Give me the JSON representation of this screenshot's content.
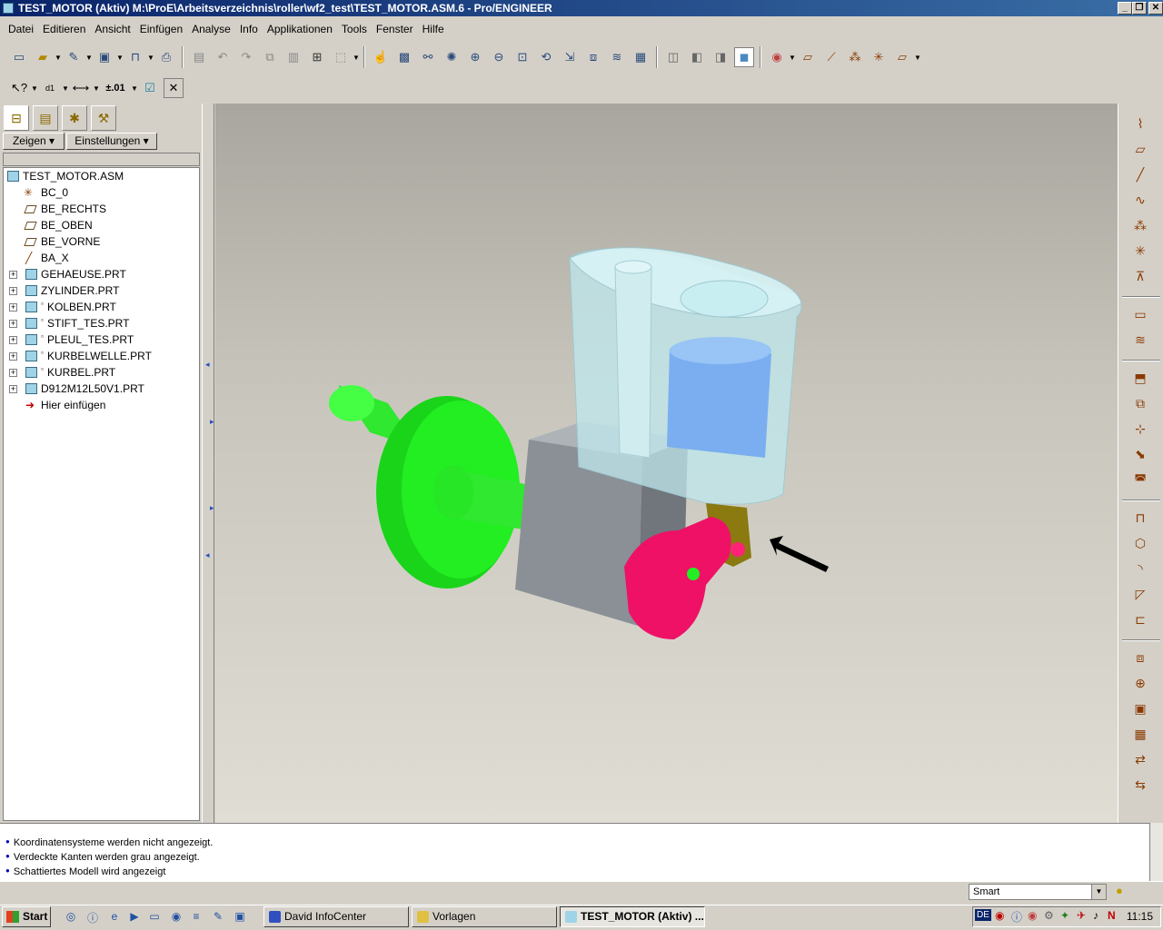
{
  "window": {
    "title": "TEST_MOTOR (Aktiv) M:\\ProE\\Arbeitsverzeichnis\\roller\\wf2_test\\TEST_MOTOR.ASM.6 - Pro/ENGINEER",
    "minimize": "_",
    "restore": "❐",
    "close": "✕"
  },
  "menu": [
    "Datei",
    "Editieren",
    "Ansicht",
    "Einfügen",
    "Analyse",
    "Info",
    "Applikationen",
    "Tools",
    "Fenster",
    "Hilfe"
  ],
  "toolbar": {
    "tolerance_label": "±.01"
  },
  "panel": {
    "show_button": "Zeigen ▾",
    "settings_button": "Einstellungen ▾"
  },
  "tree": {
    "root": "TEST_MOTOR.ASM",
    "items": [
      {
        "label": "BC_0",
        "kind": "csys",
        "icon": "✳"
      },
      {
        "label": "BE_RECHTS",
        "kind": "plane"
      },
      {
        "label": "BE_OBEN",
        "kind": "plane"
      },
      {
        "label": "BE_VORNE",
        "kind": "plane"
      },
      {
        "label": "BA_X",
        "kind": "axis",
        "icon": "╱"
      },
      {
        "label": "GEHAEUSE.PRT",
        "kind": "part"
      },
      {
        "label": "ZYLINDER.PRT",
        "kind": "part"
      },
      {
        "label": "KOLBEN.PRT",
        "kind": "part",
        "mark": "▫"
      },
      {
        "label": "STIFT_TES.PRT",
        "kind": "part",
        "mark": "▫"
      },
      {
        "label": "PLEUL_TES.PRT",
        "kind": "part",
        "mark": "▫"
      },
      {
        "label": "KURBELWELLE.PRT",
        "kind": "part",
        "mark": "▫"
      },
      {
        "label": "KURBEL.PRT",
        "kind": "part",
        "mark": "▫"
      },
      {
        "label": "D912M12L50V1.PRT",
        "kind": "part"
      },
      {
        "label": "Hier einfügen",
        "kind": "insert",
        "icon": "➜"
      }
    ]
  },
  "messages": [
    "Koordinatensysteme werden nicht angezeigt.",
    "Verdeckte Kanten werden grau angezeigt.",
    "Schattiertes Modell wird angezeigt"
  ],
  "status": {
    "filter": "Smart"
  },
  "taskbar": {
    "start": "Start",
    "buttons": [
      {
        "label": "David InfoCenter",
        "color": "#3050c0"
      },
      {
        "label": "Vorlagen",
        "color": "#e0c040"
      },
      {
        "label": "TEST_MOTOR (Aktiv) ...",
        "color": "#9fd3e8"
      }
    ],
    "lang": "DE",
    "clock": "11:15"
  },
  "colors": {
    "titlebar_start": "#0a246a",
    "flywheel": "#22ee22",
    "crank": "#ee1166",
    "housing": "#8a9096",
    "cylinder": "#bfe8ee",
    "piston": "#7aaef0",
    "rod": "#8a7a10"
  }
}
